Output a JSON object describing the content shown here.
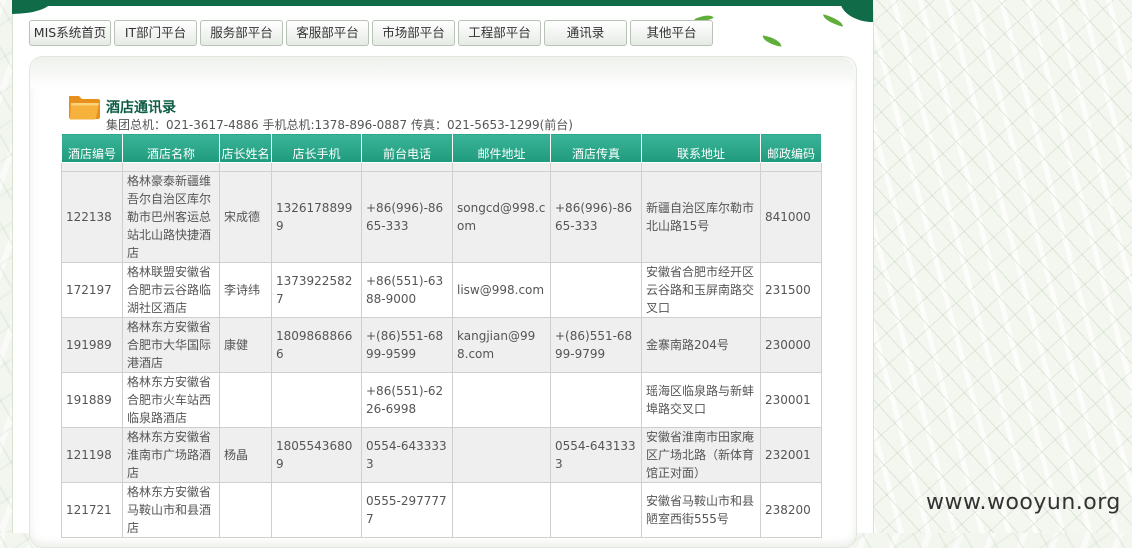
{
  "nav": {
    "tabs": [
      {
        "label": "MIS系统首页"
      },
      {
        "label": "IT部门平台"
      },
      {
        "label": "服务部平台"
      },
      {
        "label": "客服部平台"
      },
      {
        "label": "市场部平台"
      },
      {
        "label": "工程部平台"
      },
      {
        "label": "通讯录"
      },
      {
        "label": "其他平台"
      }
    ]
  },
  "section": {
    "title": "酒店通讯录",
    "contact_line": "集团总机：021-3617-4886 手机总机:1378-896-0887 传真：021-5653-1299(前台)"
  },
  "table": {
    "headers": [
      "酒店编号",
      "酒店名称",
      "店长姓名",
      "店长手机",
      "前台电话",
      "邮件地址",
      "酒店传真",
      "联系地址",
      "邮政编码"
    ],
    "rows": [
      [
        "122138",
        "格林豪泰新疆维吾尔自治区库尔勒市巴州客运总站北山路快捷酒店",
        "宋成德",
        "13261788999",
        "+86(996)-8665-333",
        "songcd@998.com",
        "+86(996)-8665-333",
        "新疆自治区库尔勒市北山路15号",
        "841000"
      ],
      [
        "172197",
        "格林联盟安徽省合肥市云谷路临湖社区酒店",
        "李诗纬",
        "13739225827",
        "+86(551)-6388-9000",
        "lisw@998.com",
        "",
        "安徽省合肥市经开区云谷路和玉屏南路交叉口",
        "231500"
      ],
      [
        "191989",
        "格林东方安徽省合肥市大华国际港酒店",
        "康健",
        "18098688666",
        "+(86)551-6899-9599",
        "kangjian@998.com",
        "+(86)551-6899-9799",
        "金寨南路204号",
        "230000"
      ],
      [
        "191889",
        "格林东方安徽省合肥市火车站西临泉路酒店",
        "",
        "",
        "+86(551)-6226-6998",
        "",
        "",
        "瑶海区临泉路与新蚌埠路交叉口",
        "230001"
      ],
      [
        "121198",
        "格林东方安徽省淮南市广场路酒店",
        "杨晶",
        "18055436809",
        "0554-6433333",
        "",
        "0554-6431333",
        "安徽省淮南市田家庵区广场北路（新体育馆正对面）",
        "232001"
      ],
      [
        "121721",
        "格林东方安徽省马鞍山市和县酒店",
        "",
        "",
        "0555-2977777",
        "",
        "",
        "安徽省马鞍山市和县陋室西街555号",
        "238200"
      ]
    ]
  },
  "watermark": "www.wooyun.org",
  "icons": {
    "section": "folder-icon"
  },
  "colors": {
    "brand": "#0f6b48",
    "header": "#2aa88a",
    "title": "#0d5d45"
  }
}
